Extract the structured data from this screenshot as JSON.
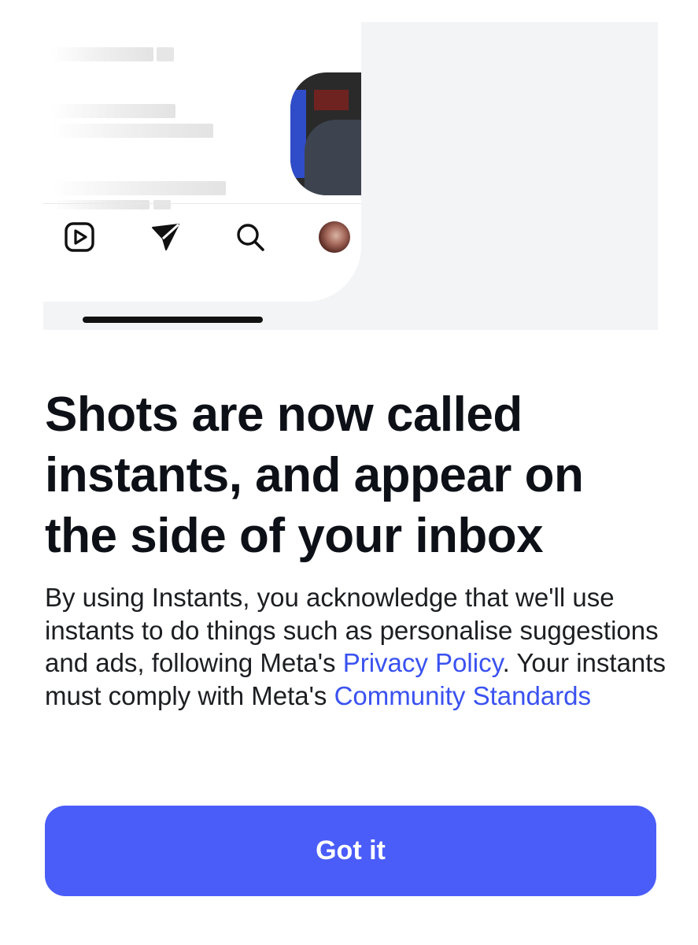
{
  "illustration": {
    "tabbar": {
      "icons": [
        "reels-icon",
        "send-icon",
        "search-icon",
        "profile-avatar"
      ]
    }
  },
  "dialog": {
    "title": "Shots are now called instants, and appear on the side of your inbox",
    "body": {
      "text_1": "By using Instants, you acknowledge that we'll use instants to do things such as personalise suggestions and ads, following Meta's ",
      "privacy_link": "Privacy Policy",
      "text_2": ". Your instants must comply with Meta's ",
      "community_link": "Community Standards"
    },
    "button_label": "Got it"
  },
  "colors": {
    "accent": "#4a5df9",
    "link": "#3a52f0",
    "title": "#0d1117",
    "illustration_bg": "#f3f4f6"
  }
}
